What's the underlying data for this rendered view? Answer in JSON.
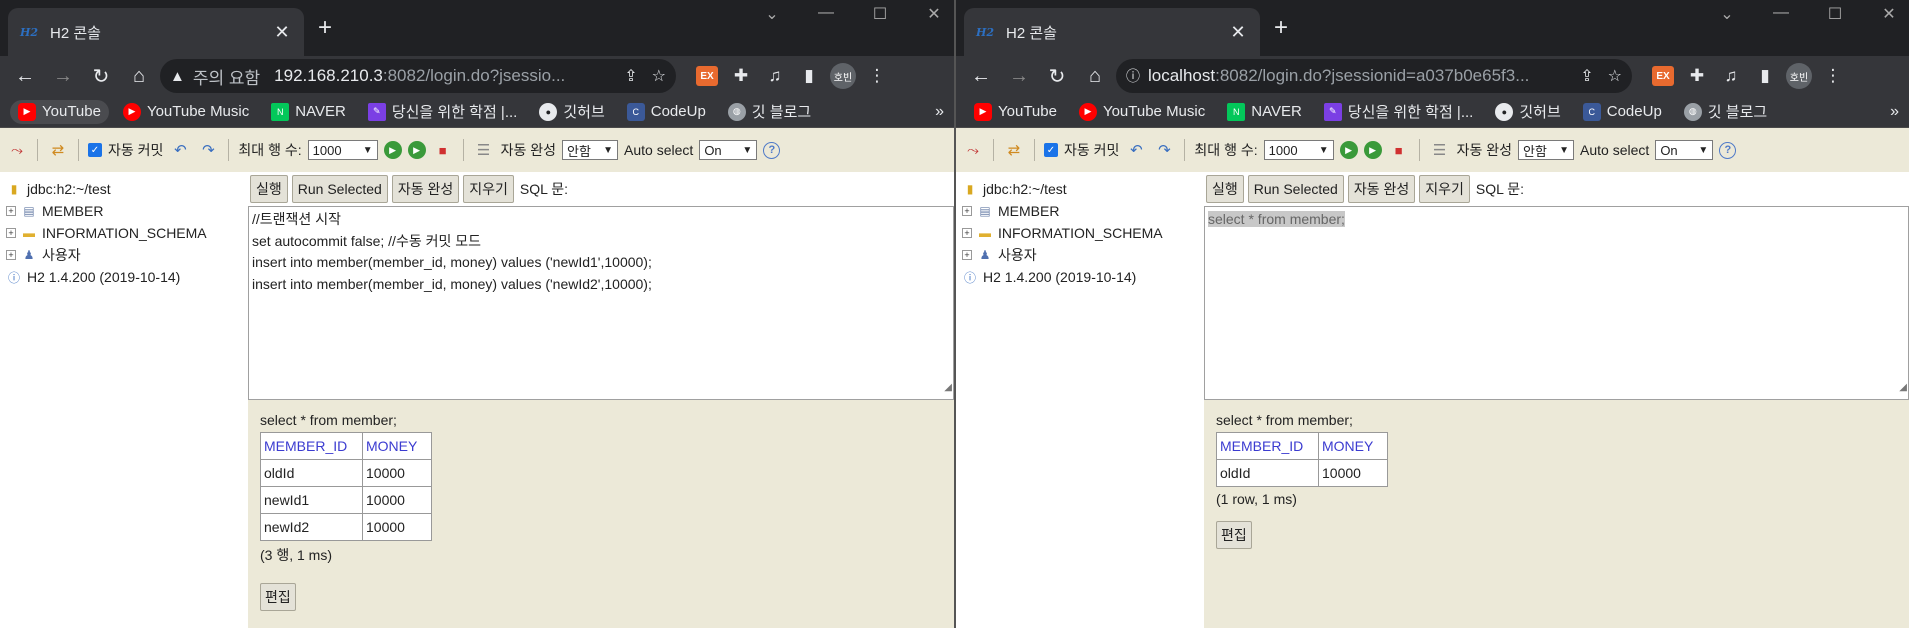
{
  "windows": [
    {
      "tab_title": "H2 콘솔",
      "address": {
        "warning_text": "주의 요함",
        "host": "192.168.210.3",
        "path": ":8082/login.do?jsessio..."
      },
      "profile_label": "호빈",
      "bookmarks": [
        "YouTube",
        "YouTube Music",
        "NAVER",
        "당신을 위한 학점 |...",
        "깃허브",
        "CodeUp",
        "깃 블로그"
      ],
      "toolbar": {
        "autocommit_label": "자동 커밋",
        "max_rows_label": "최대 행 수:",
        "max_rows_value": "1000",
        "autocomplete_label": "자동 완성",
        "autocomplete_value": "안함",
        "auto_select_label": "Auto select",
        "auto_select_value": "On"
      },
      "tree": {
        "connection": "jdbc:h2:~/test",
        "member": "MEMBER",
        "info_schema": "INFORMATION_SCHEMA",
        "users": "사용자",
        "version": "H2 1.4.200 (2019-10-14)"
      },
      "sqlbar": {
        "run": "실행",
        "run_selected": "Run Selected",
        "autocomplete": "자동 완성",
        "clear": "지우기",
        "sql_label": "SQL 문:"
      },
      "editor_lines": [
        "//트랜잭션 시작",
        "set autocommit false; //수동 커밋 모드",
        "insert into member(member_id, money) values ('newId1',10000);",
        "insert into member(member_id, money) values ('newId2',10000);"
      ],
      "result": {
        "query": "select * from member;",
        "columns": [
          "MEMBER_ID",
          "MONEY"
        ],
        "rows": [
          [
            "oldId",
            "10000"
          ],
          [
            "newId1",
            "10000"
          ],
          [
            "newId2",
            "10000"
          ]
        ],
        "row_count": "(3 행, 1 ms)",
        "edit_label": "편집"
      }
    },
    {
      "tab_title": "H2 콘솔",
      "address": {
        "warning_text": "",
        "host": "localhost",
        "path": ":8082/login.do?jsessionid=a037b0e65f3..."
      },
      "profile_label": "호빈",
      "bookmarks": [
        "YouTube",
        "YouTube Music",
        "NAVER",
        "당신을 위한 학점 |...",
        "깃허브",
        "CodeUp",
        "깃 블로그"
      ],
      "toolbar": {
        "autocommit_label": "자동 커밋",
        "max_rows_label": "최대 행 수:",
        "max_rows_value": "1000",
        "autocomplete_label": "자동 완성",
        "autocomplete_value": "안함",
        "auto_select_label": "Auto select",
        "auto_select_value": "On"
      },
      "tree": {
        "connection": "jdbc:h2:~/test",
        "member": "MEMBER",
        "info_schema": "INFORMATION_SCHEMA",
        "users": "사용자",
        "version": "H2 1.4.200 (2019-10-14)"
      },
      "sqlbar": {
        "run": "실행",
        "run_selected": "Run Selected",
        "autocomplete": "자동 완성",
        "clear": "지우기",
        "sql_label": "SQL 문:"
      },
      "editor_selected": "select * from member;",
      "result": {
        "query": "select * from member;",
        "columns": [
          "MEMBER_ID",
          "MONEY"
        ],
        "rows": [
          [
            "oldId",
            "10000"
          ]
        ],
        "row_count": "(1 row, 1 ms)",
        "edit_label": "편집"
      }
    }
  ]
}
